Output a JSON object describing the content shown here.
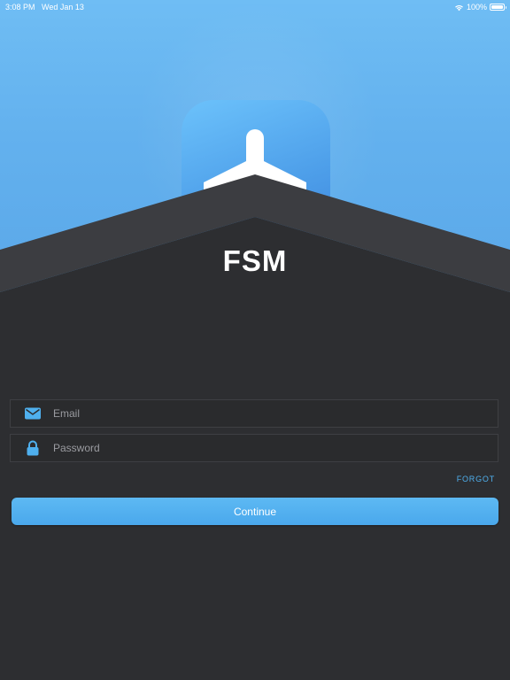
{
  "status_bar": {
    "time": "3:08 PM",
    "date": "Wed Jan 13",
    "battery": "100%",
    "wifi_icon": "wifi-icon",
    "battery_icon": "battery-icon"
  },
  "app": {
    "name": "FSM",
    "logo_icon": "airplane-icon"
  },
  "login_form": {
    "email": {
      "icon": "envelope-icon",
      "placeholder": "Email",
      "value": ""
    },
    "password": {
      "icon": "lock-icon",
      "placeholder": "Password",
      "value": ""
    },
    "forgot_label": "FORGOT",
    "continue_label": "Continue"
  },
  "colors": {
    "sky": "#63b1ee",
    "background": "#2c2d30",
    "accent": "#4fb0ee",
    "button": "#4aa8ec",
    "text": "#ffffff"
  }
}
